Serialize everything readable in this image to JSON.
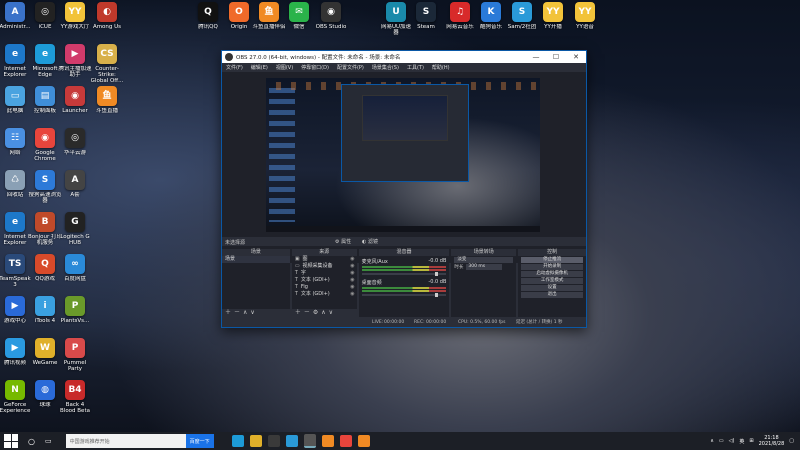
{
  "desktop": {
    "icons": [
      {
        "label": "Administr...",
        "color": "#3a72c9",
        "glyph": "A"
      },
      {
        "label": "iCUE",
        "color": "#222",
        "glyph": "◎"
      },
      {
        "label": "YY游戏大厅",
        "color": "#f2c33a",
        "glyph": "YY"
      },
      {
        "label": "Among Us",
        "color": "#c0392b",
        "glyph": "◐"
      },
      {
        "label": "Internet Explorer",
        "color": "#1d78c9",
        "glyph": "e"
      },
      {
        "label": "Microsoft Edge",
        "color": "#1d9bd8",
        "glyph": "e"
      },
      {
        "label": "腾讯主播加速助手",
        "color": "#d13b6b",
        "glyph": "▶"
      },
      {
        "label": "Counter-Strike: Global Off...",
        "color": "#d8b04a",
        "glyph": "CS"
      },
      {
        "label": "此电脑",
        "color": "#4aa3e0",
        "glyph": "▭"
      },
      {
        "label": "控制面板",
        "color": "#3f8ed8",
        "glyph": "▤"
      },
      {
        "label": "Launcher",
        "color": "#c73a3a",
        "glyph": "◉"
      },
      {
        "label": "斗鱼直播",
        "color": "#f08a24",
        "glyph": "鱼"
      },
      {
        "label": "网络",
        "color": "#4a90e2",
        "glyph": "☷"
      },
      {
        "label": "Google Chrome",
        "color": "#e8453c",
        "glyph": "◉"
      },
      {
        "label": "华平云游",
        "color": "#2a2a2a",
        "glyph": "◎"
      },
      {
        "label": "回收站",
        "color": "#8aa0b5",
        "glyph": "♺"
      },
      {
        "label": "搜狗高速浏览器",
        "color": "#2d7ad8",
        "glyph": "S"
      },
      {
        "label": "A套",
        "color": "#444",
        "glyph": "A"
      },
      {
        "label": "Internet Explorer",
        "color": "#1d78c9",
        "glyph": "e"
      },
      {
        "label": "Bonjour 打印机服务",
        "color": "#c04a2a",
        "glyph": "B"
      },
      {
        "label": "Logitech G HUB",
        "color": "#222",
        "glyph": "G"
      },
      {
        "label": "TeamSpeak 3",
        "color": "#2a4a7a",
        "glyph": "TS"
      },
      {
        "label": "QQ游戏",
        "color": "#d84a2a",
        "glyph": "Q"
      },
      {
        "label": "百度网盘",
        "color": "#2a8ad8",
        "glyph": "∞"
      },
      {
        "label": "游戏中心",
        "color": "#2a6ad8",
        "glyph": "▶"
      },
      {
        "label": "iTools 4",
        "color": "#3aa0e0",
        "glyph": "i"
      },
      {
        "label": "PlantsVs...",
        "color": "#6a9a2a",
        "glyph": "P"
      },
      {
        "label": "腾讯视频",
        "color": "#2a9ae0",
        "glyph": "▶"
      },
      {
        "label": "WeGame",
        "color": "#e0b02a",
        "glyph": "W"
      },
      {
        "label": "Pummel Party",
        "color": "#d84a4a",
        "glyph": "P"
      },
      {
        "label": "GeForce Experience",
        "color": "#76b900",
        "glyph": "N"
      },
      {
        "label": "球球",
        "color": "#2a6ad8",
        "glyph": "◍"
      },
      {
        "label": "Back 4 Blood Beta",
        "color": "#c82a2a",
        "glyph": "B4"
      }
    ],
    "top_icons": [
      {
        "label": "腾讯QQ",
        "color": "#111",
        "glyph": "Q"
      },
      {
        "label": "Origin",
        "color": "#f06a2a",
        "glyph": "O"
      },
      {
        "label": "斗鱼直播伴侣",
        "color": "#f08a24",
        "glyph": "鱼"
      },
      {
        "label": "微信",
        "color": "#2ab34a",
        "glyph": "✉"
      },
      {
        "label": "OBS Studio",
        "color": "#333",
        "glyph": "◉"
      },
      {
        "label": "网易UU加速器",
        "color": "#1a8aaa",
        "glyph": "U"
      },
      {
        "label": "Steam",
        "color": "#1b2838",
        "glyph": "S"
      },
      {
        "label": "网易云音乐",
        "color": "#d82a2a",
        "glyph": "♫"
      },
      {
        "label": "酷狗音乐",
        "color": "#2a7ad8",
        "glyph": "K"
      },
      {
        "label": "Sam/2社团",
        "color": "#2a9ad8",
        "glyph": "S"
      },
      {
        "label": "YY开播",
        "color": "#f2c33a",
        "glyph": "YY"
      },
      {
        "label": "YY语音",
        "color": "#f2c33a",
        "glyph": "YY"
      }
    ]
  },
  "obs": {
    "title": "OBS 27.0.0 (64-bit, windows) - 配置文件: 未命名 - 场景: 未命名",
    "menu": [
      "文件(F)",
      "编辑(E)",
      "视图(V)",
      "停靠窗口(D)",
      "配置文件(P)",
      "场景集合(S)",
      "工具(T)",
      "帮助(H)"
    ],
    "no_scene": "未选择源",
    "props_btn": "属性",
    "filter_btn": "滤镜",
    "scenes": {
      "header": "场景",
      "items": [
        "场景"
      ]
    },
    "sources": {
      "header": "来源",
      "items": [
        {
          "icon": "▣",
          "name": "图"
        },
        {
          "icon": "▭",
          "name": "视频采集设备"
        },
        {
          "icon": "T",
          "name": "字"
        },
        {
          "icon": "T",
          "name": "文本 (GDI+)"
        },
        {
          "icon": "T",
          "name": "Fig"
        },
        {
          "icon": "T",
          "name": "文本 (GDI+)"
        }
      ]
    },
    "mixer": {
      "header": "混音器",
      "channels": [
        {
          "name": "麦克风/Aux",
          "db": "-0.0 dB"
        },
        {
          "name": "桌面音频",
          "db": "-0.0 dB"
        }
      ]
    },
    "transitions": {
      "header": "场景转场",
      "type": "淡变",
      "duration_label": "时长",
      "duration": "300 ms"
    },
    "controls": {
      "header": "控制",
      "buttons": [
        "停止推流",
        "开始录制",
        "启动虚拟摄像机",
        "工作室模式",
        "设置",
        "退出"
      ]
    },
    "status": {
      "live_label": "LIVE:",
      "live": "00:00:00",
      "rec_label": "REC:",
      "rec": "00:00:00",
      "cpu": "CPU: 0.5%, 60.00 fps",
      "extra": "延迟 (总计 / 转换) 1 秒"
    }
  },
  "taskbar": {
    "search_placeholder": "中国游戏推荐开始",
    "search_button": "百度一下",
    "time": "21:18",
    "date": "2021/8/28",
    "lang": "英"
  }
}
